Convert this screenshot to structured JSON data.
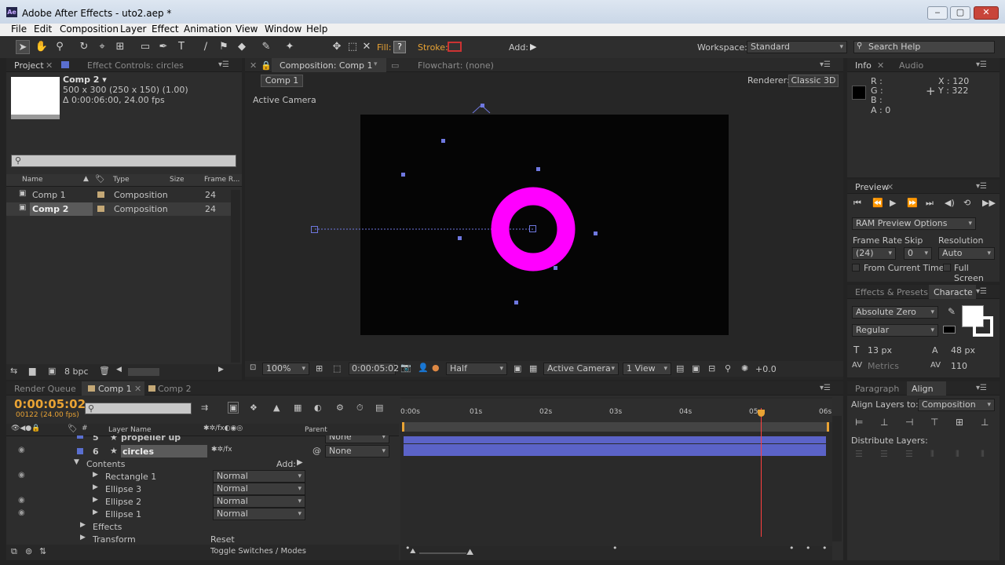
{
  "window": {
    "title": "Adobe After Effects - uto2.aep *",
    "app_icon": "Ae",
    "min": "‒",
    "max": "▢",
    "close": "✕"
  },
  "menu": [
    "File",
    "Edit",
    "Composition",
    "Layer",
    "Effect",
    "Animation",
    "View",
    "Window",
    "Help"
  ],
  "toolbar": {
    "fill_label": "Fill:",
    "stroke_label": "Stroke:",
    "add_label": "Add:",
    "workspace_label": "Workspace:",
    "workspace_value": "Standard",
    "search_placeholder": "Search Help"
  },
  "project": {
    "tab_project": "Project",
    "tab_effects": "Effect Controls: circles",
    "item_name": "Comp 2 ▾",
    "item_dims": "500 x 300  (250 x 150) (1.00)",
    "item_dur": "Δ 0:00:06:00, 24.00 fps",
    "columns": [
      "Name",
      "Type",
      "Size",
      "Frame R..."
    ],
    "rows": [
      {
        "name": "Comp 1",
        "type": "Composition",
        "fr": "24"
      },
      {
        "name": "Comp 2",
        "type": "Composition",
        "fr": "24"
      }
    ],
    "bpc": "8 bpc"
  },
  "comp": {
    "tab": "Composition: Comp 1",
    "flowchart": "Flowchart: (none)",
    "crumb": "Comp 1",
    "renderer_label": "Renderer:",
    "renderer": "Classic 3D",
    "camera_label": "Active Camera",
    "zoom": "100%",
    "time": "0:00:05:02",
    "resolution": "Half",
    "camera": "Active Camera",
    "views": "1 View",
    "exposure": "+0.0"
  },
  "info": {
    "tab_info": "Info",
    "tab_audio": "Audio",
    "r": "R :",
    "g": "G :",
    "b": "B :",
    "a": "A : 0",
    "x": "X : 120",
    "y": "Y : 322"
  },
  "preview": {
    "tab": "Preview",
    "ram": "RAM Preview Options",
    "frame_rate_label": "Frame Rate",
    "skip_label": "Skip",
    "res_label": "Resolution",
    "frame_rate": "(24)",
    "skip": "0",
    "res": "Auto",
    "from_current": "From Current Time",
    "full_screen": "Full Screen"
  },
  "character": {
    "tab_effects": "Effects & Presets",
    "tab_char": "Characte",
    "font": "Absolute Zero",
    "style": "Regular",
    "size": "13 px",
    "leading": "48 px",
    "metrics": "Metrics",
    "tracking": "110"
  },
  "timeline": {
    "tab_render": "Render Queue",
    "tab_comp1": "Comp 1",
    "tab_comp2": "Comp 2",
    "timecode": "0:00:05:02",
    "frames": "00122 (24.00 fps)",
    "ruler": [
      "0:00s",
      "01s",
      "02s",
      "03s",
      "04s",
      "05s",
      "06s"
    ],
    "col_layer": "Layer Name",
    "col_parent": "Parent",
    "layers": [
      {
        "num": "5",
        "name": "propeller up",
        "parent": "None"
      },
      {
        "num": "6",
        "name": "circles",
        "parent": "None"
      }
    ],
    "contents": "Contents",
    "add": "Add:",
    "items": [
      {
        "name": "Rectangle 1",
        "mode": "Normal"
      },
      {
        "name": "Ellipse 3",
        "mode": "Normal"
      },
      {
        "name": "Ellipse 2",
        "mode": "Normal"
      },
      {
        "name": "Ellipse 1",
        "mode": "Normal"
      }
    ],
    "effects": "Effects",
    "transform": "Transform",
    "reset": "Reset",
    "toggle": "Toggle Switches / Modes"
  },
  "align": {
    "tab_para": "Paragraph",
    "tab_align": "Align",
    "align_to_label": "Align Layers to:",
    "align_to": "Composition",
    "distribute": "Distribute Layers:"
  },
  "colors": {
    "accent": "#e9a334",
    "ring": "#ff00ff",
    "layer_bar": "#5b63c8",
    "playhead": "#ff4040"
  }
}
